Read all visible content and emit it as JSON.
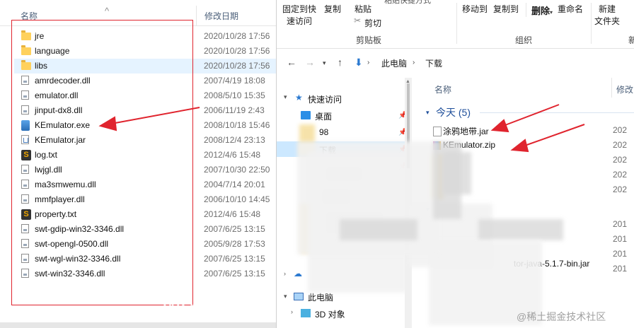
{
  "left_pane": {
    "headers": {
      "name": "名称",
      "modified": "修改日期"
    },
    "files": [
      {
        "name": "jre",
        "date": "2020/10/28 17:56",
        "icon": "folder-icon"
      },
      {
        "name": "language",
        "date": "2020/10/28 17:56",
        "icon": "folder-icon"
      },
      {
        "name": "libs",
        "date": "2020/10/28 17:56",
        "icon": "folder-icon"
      },
      {
        "name": "amrdecoder.dll",
        "date": "2007/4/19 18:08",
        "icon": "dll-file-icon"
      },
      {
        "name": "emulator.dll",
        "date": "2008/5/10 15:35",
        "icon": "dll-file-icon"
      },
      {
        "name": "jinput-dx8.dll",
        "date": "2006/11/19 2:43",
        "icon": "dll-file-icon"
      },
      {
        "name": "KEmulator.exe",
        "date": "2008/10/18 15:46",
        "icon": "exe-file-icon"
      },
      {
        "name": "KEmulator.jar",
        "date": "2008/12/4 23:13",
        "icon": "jar-file-icon"
      },
      {
        "name": "log.txt",
        "date": "2012/4/6 15:48",
        "icon": "sublime-text-icon"
      },
      {
        "name": "lwjgl.dll",
        "date": "2007/10/30 22:50",
        "icon": "dll-file-icon"
      },
      {
        "name": "ma3smwemu.dll",
        "date": "2004/7/14 20:01",
        "icon": "dll-file-icon"
      },
      {
        "name": "mmfplayer.dll",
        "date": "2006/10/10 14:45",
        "icon": "dll-file-icon"
      },
      {
        "name": "property.txt",
        "date": "2012/4/6 15:48",
        "icon": "sublime-text-icon"
      },
      {
        "name": "swt-gdip-win32-3346.dll",
        "date": "2007/6/25 13:15",
        "icon": "dll-file-icon"
      },
      {
        "name": "swt-opengl-0500.dll",
        "date": "2005/9/28 17:53",
        "icon": "dll-file-icon"
      },
      {
        "name": "swt-wgl-win32-3346.dll",
        "date": "2007/6/25 13:15",
        "icon": "dll-file-icon"
      },
      {
        "name": "swt-win32-3346.dll",
        "date": "2007/6/25 13:15",
        "icon": "dll-file-icon"
      }
    ]
  },
  "ribbon": {
    "pin_quick_access": "固定到快",
    "pin_quick_access_2": "速访问",
    "copy": "复制",
    "paste": "粘贴",
    "cut": "剪切",
    "paste_shortcut_partial": "粘贴快捷方式",
    "clipboard_group": "剪贴板",
    "move_to": "移动到",
    "copy_to": "复制到",
    "delete": "删除",
    "rename": "重命名",
    "organize_group": "组织",
    "new_folder_1": "新建",
    "new_folder_2": "文件夹",
    "new_group_partial": "新"
  },
  "address_bar": {
    "segments": [
      "此电脑",
      "下载"
    ]
  },
  "nav_pane": {
    "quick_access": "快速访问",
    "desktop": "桌面",
    "item_98": "98",
    "downloads": "下载",
    "this_pc": "此电脑",
    "objects_3d": "3D 对象"
  },
  "content": {
    "name_header": "名称",
    "modified_header": "修改",
    "today_group": "今天 (5)",
    "files": [
      {
        "name": "涂鸦地带.jar",
        "date": "202"
      },
      {
        "name": "KEmulator.zip",
        "date": "202"
      }
    ],
    "other_dates": [
      "202",
      "202",
      "202"
    ],
    "partial_name": "tor-java-5.1.7-bin.jar",
    "partial_dates": [
      "201",
      "201",
      "201",
      "201"
    ]
  },
  "watermark": {
    "text": "weixin",
    "site": "@稀土掘金技术社区"
  },
  "colors": {
    "annotation_red": "#e0242e",
    "selection": "#cce8ff",
    "row_select": "#e5f3ff"
  }
}
